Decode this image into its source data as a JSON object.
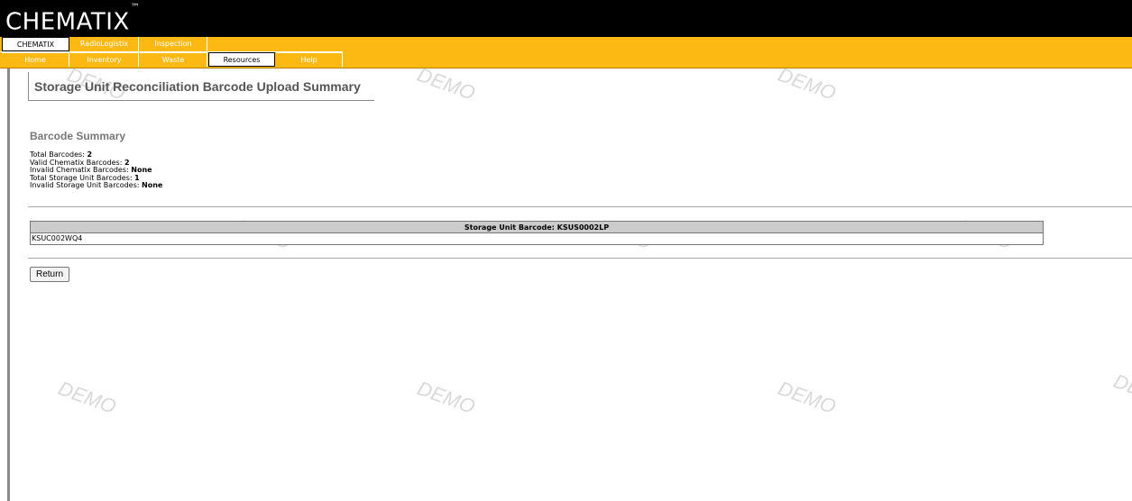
{
  "brand": {
    "name": "CHEMATIX",
    "tm": "™"
  },
  "tabs_row1": [
    {
      "label": "CHEMATIX",
      "active": true
    },
    {
      "label": "RadioLogistix",
      "active": false
    },
    {
      "label": "Inspection",
      "active": false
    }
  ],
  "tabs_row2": [
    {
      "label": "Home",
      "active": false
    },
    {
      "label": "Inventory",
      "active": false
    },
    {
      "label": "Waste",
      "active": false
    },
    {
      "label": "Resources",
      "active": true
    },
    {
      "label": "Help",
      "active": false
    }
  ],
  "page": {
    "title": "Storage Unit Reconciliation Barcode Upload Summary"
  },
  "summary": {
    "heading": "Barcode Summary",
    "rows": [
      {
        "label": "Total Barcodes: ",
        "value": "2"
      },
      {
        "label": "Valid Chematix Barcodes: ",
        "value": "2"
      },
      {
        "label": "Invalid Chematix Barcodes: ",
        "value": "None"
      },
      {
        "label": "Total Storage Unit Barcodes: ",
        "value": "1"
      },
      {
        "label": "Invalid Storage Unit Barcodes: ",
        "value": "None"
      }
    ]
  },
  "table": {
    "header": "Storage Unit Barcode: KSUS0002LP",
    "rows": [
      "KSUC002WQ4"
    ]
  },
  "buttons": {
    "return_label": "Return"
  },
  "watermark": {
    "text": "DEMO"
  },
  "colors": {
    "nav": "#fcb913",
    "header": "#000000",
    "table_header": "#cccccc"
  }
}
